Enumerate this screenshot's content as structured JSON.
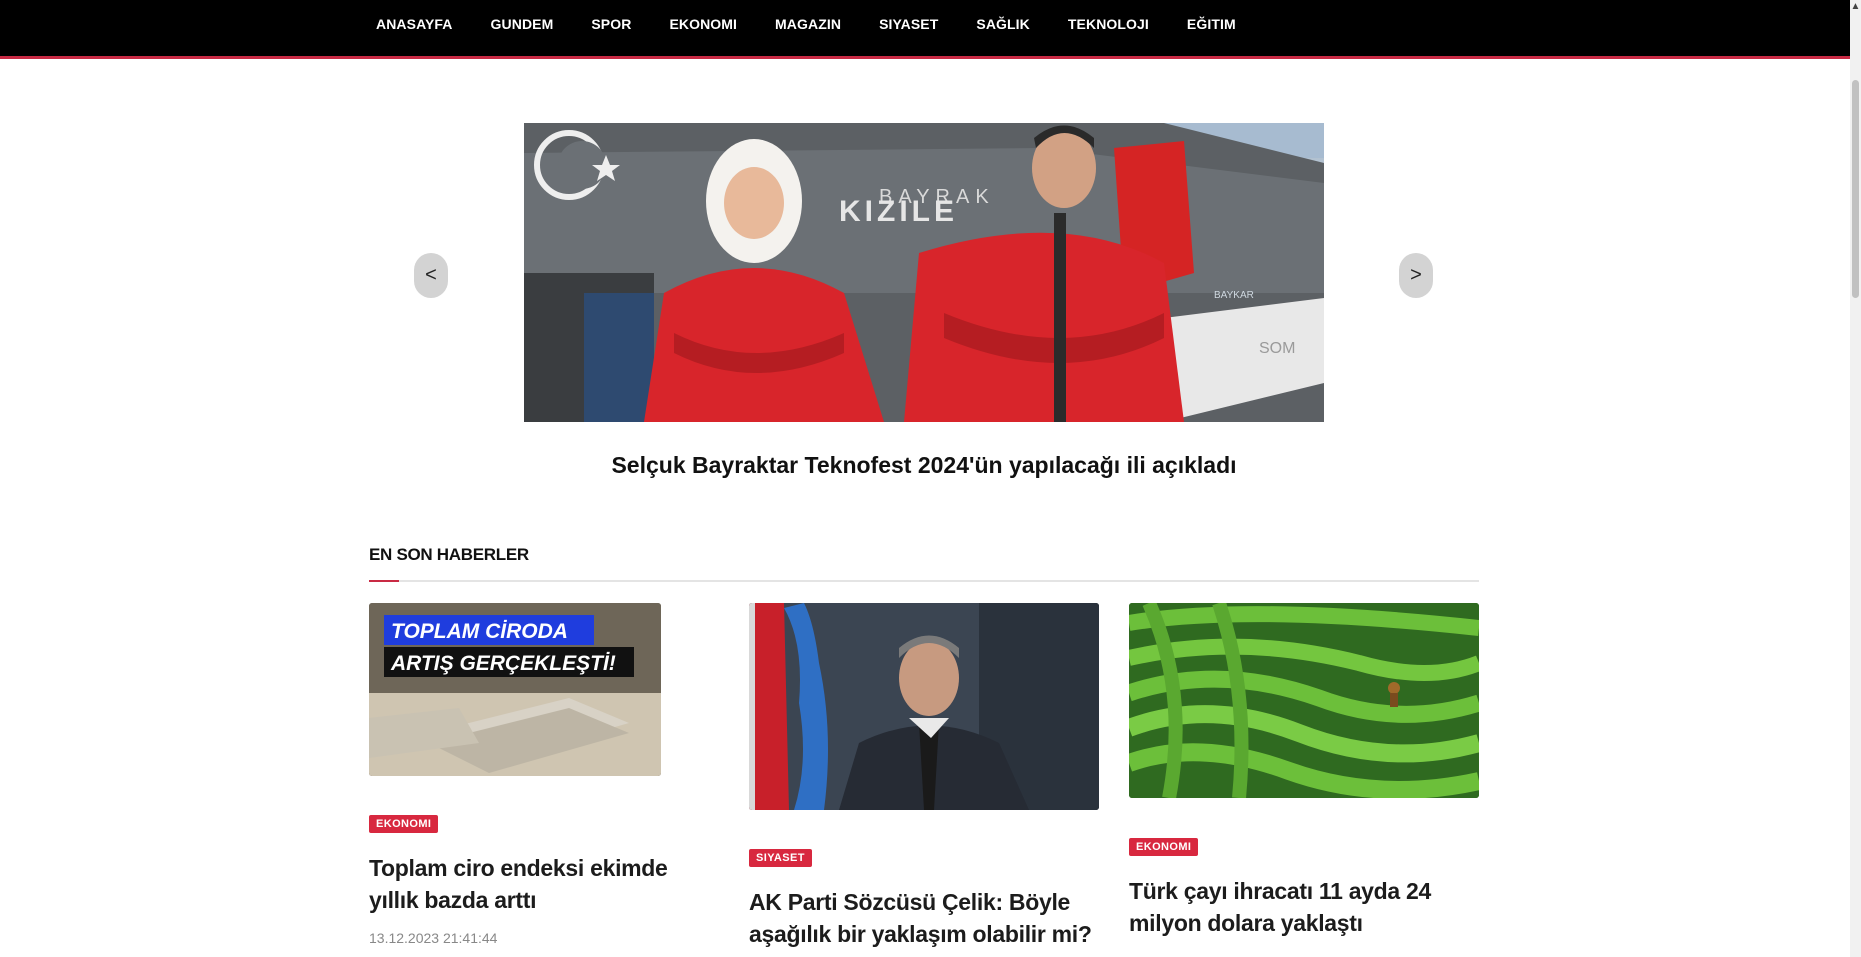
{
  "nav": {
    "items": [
      "ANASAYFA",
      "GUNDEM",
      "SPOR",
      "EKONOMI",
      "MAGAZIN",
      "SIYASET",
      "SAĞLIK",
      "TEKNOLOJI",
      "EĞITIM"
    ]
  },
  "slider": {
    "prev_label": "<",
    "next_label": ">",
    "headline": "Selçuk Bayraktar Teknofest 2024'ün yapılacağı ili açıkladı",
    "image_text_1": "BAYRAK",
    "image_text_2": "KIZILE",
    "image_text_3": "SOM",
    "image_text_4": "BAYKAR"
  },
  "section": {
    "title": "EN SON HABERLER"
  },
  "cards": [
    {
      "category": "EKONOMI",
      "title": "Toplam ciro endeksi ekimde yıllık bazda arttı",
      "date": "13.12.2023 21:41:44",
      "image_line_1": "TOPLAM CİRODA",
      "image_line_2": "ARTIŞ GERÇEKLEŞTİ!"
    },
    {
      "category": "SIYASET",
      "title": "AK Parti Sözcüsü Çelik: Böyle aşağılık bir yaklaşım olabilir mi?"
    },
    {
      "category": "EKONOMI",
      "title": "Türk çayı ihracatı 11 ayda 24 milyon dolara yaklaştı"
    }
  ],
  "colors": {
    "accent": "#c92a44",
    "badge": "#d8283f",
    "nav_bg": "#000000"
  }
}
